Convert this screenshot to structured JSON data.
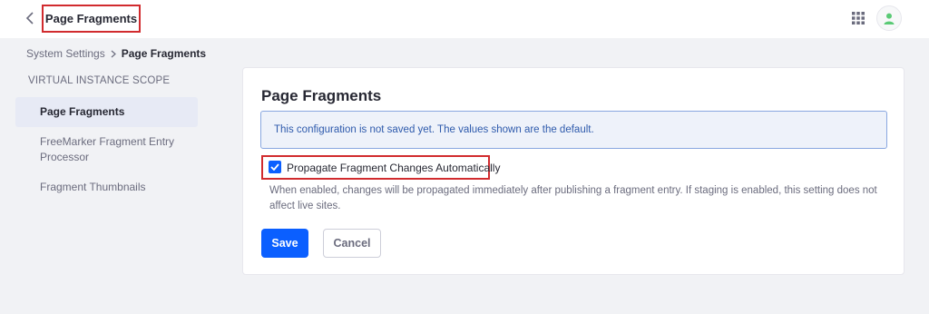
{
  "header": {
    "title": "Page Fragments",
    "back_icon": "chevron-left-icon",
    "apps_icon": "grid-icon",
    "avatar_icon": "user-icon"
  },
  "breadcrumb": {
    "parent": "System Settings",
    "current": "Page Fragments"
  },
  "sidebar": {
    "scope_label": "VIRTUAL INSTANCE SCOPE",
    "items": [
      {
        "label": "Page Fragments",
        "active": true
      },
      {
        "label_line1": "FreeMarker Fragment Entry",
        "label_line2": "Processor",
        "active": false
      },
      {
        "label": "Fragment Thumbnails",
        "active": false
      }
    ]
  },
  "main": {
    "title": "Page Fragments",
    "alert": "This configuration is not saved yet. The values shown are the default.",
    "checkbox": {
      "label": "Propagate Fragment Changes Automatically",
      "checked": true
    },
    "help_line1": "When enabled, changes will be propagated immediately after publishing a fragment entry. If staging is enabled, this setting does not",
    "help_line2": "affect live sites.",
    "save_label": "Save",
    "cancel_label": "Cancel"
  },
  "colors": {
    "primary": "#0b5fff",
    "highlight_outline": "#d12b2e",
    "alert_text": "#2e5aac",
    "avatar_green": "#5aca75"
  }
}
